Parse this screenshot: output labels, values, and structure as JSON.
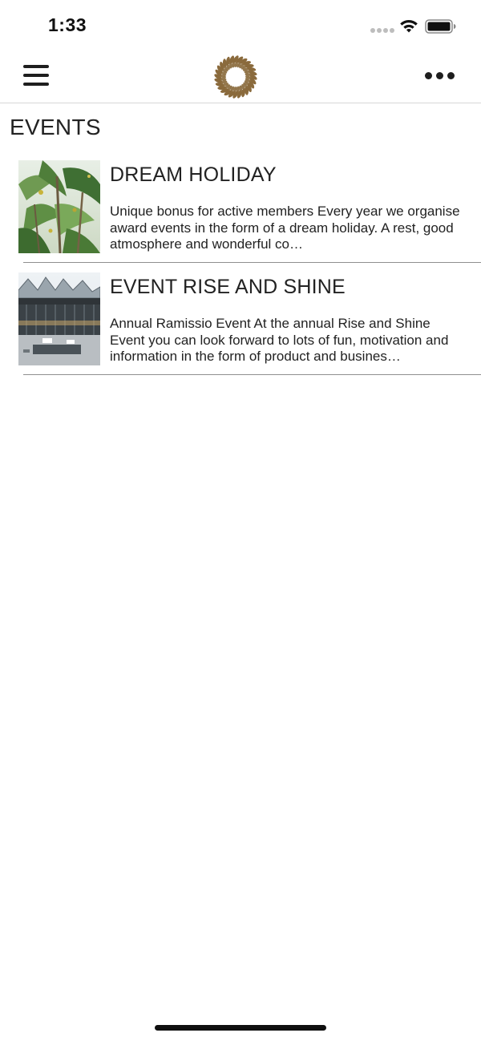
{
  "status_bar": {
    "time": "1:33",
    "signal_icon": "cellular-dots-icon",
    "wifi_icon": "wifi-icon",
    "battery_icon": "battery-icon"
  },
  "nav": {
    "menu_icon": "hamburger-menu-icon",
    "logo_icon": "laurel-wreath-logo",
    "more_icon": "more-dots-icon",
    "logo_color": "#8a6a3c"
  },
  "page": {
    "title": "EVENTS"
  },
  "events": [
    {
      "title": "DREAM HOLIDAY",
      "description": "Unique bonus for active members  Every year we organise award events in the form of a dream holiday. A rest, good atmosphere and wonderful co…",
      "thumbnail": "palm-trees-image"
    },
    {
      "title": "EVENT RISE AND SHINE",
      "description": "Annual Ramissio Event  At the annual Rise and Shine Event you can look forward to lots of fun, motivation and information in the form of product and busines…",
      "thumbnail": "event-venue-building-image"
    }
  ]
}
